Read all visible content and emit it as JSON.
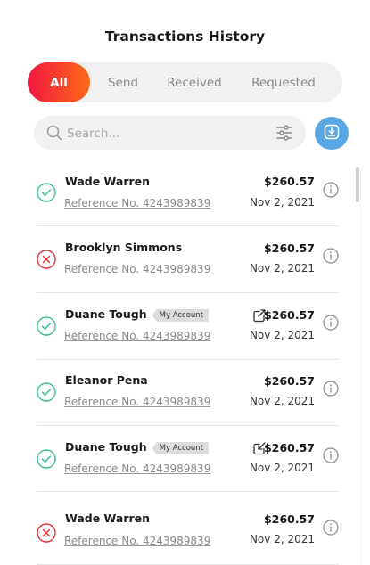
{
  "header": {
    "title": "Transactions History"
  },
  "tabs": [
    {
      "label": "All",
      "active": true
    },
    {
      "label": "Send",
      "active": false
    },
    {
      "label": "Received",
      "active": false
    },
    {
      "label": "Requested",
      "active": false
    }
  ],
  "search": {
    "placeholder": "Search...",
    "value": ""
  },
  "colors": {
    "success": "#3fbf8f",
    "failed": "#e5343b",
    "tab_gradient_start": "#f0183f",
    "tab_gradient_end": "#ff6a1a",
    "download_button": "#5aa7e6"
  },
  "icons": {
    "search": "search-icon",
    "filter": "filter-sliders-icon",
    "download": "download-icon",
    "success": "check-circle-icon",
    "failed": "x-circle-icon",
    "info": "info-icon",
    "share": "share-icon"
  },
  "transactions": [
    {
      "status": "success",
      "name": "Wade Warren",
      "badge": "",
      "reference": "Reference No. 4243989839",
      "amount": "$260.57",
      "date": "Nov 2, 2021"
    },
    {
      "status": "failed",
      "name": "Brooklyn Simmons",
      "badge": "",
      "reference": "Reference No. 4243989839",
      "amount": "$260.57",
      "date": "Nov 2, 2021"
    },
    {
      "status": "success",
      "name": "Duane Tough",
      "badge": "My Account",
      "reference": "Reference No. 4243989839",
      "amount": "$260.57",
      "date": "Nov 2, 2021"
    },
    {
      "status": "success",
      "name": "Eleanor Pena",
      "badge": "",
      "reference": "Reference No. 4243989839",
      "amount": "$260.57",
      "date": "Nov 2, 2021"
    },
    {
      "status": "success",
      "name": "Duane Tough",
      "badge": "My Account",
      "reference": "Reference No. 4243989839",
      "amount": "$260.57",
      "date": "Nov 2, 2021"
    },
    {
      "status": "failed",
      "name": "Wade Warren",
      "badge": "",
      "reference": "Reference No. 4243989839",
      "amount": "$260.57",
      "date": "Nov 2, 2021"
    }
  ]
}
